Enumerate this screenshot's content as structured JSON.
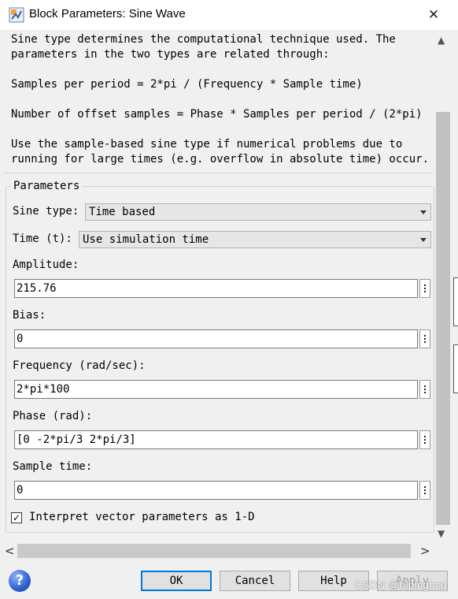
{
  "window": {
    "title": "Block Parameters: Sine Wave",
    "close_glyph": "✕",
    "icon": "simulink-block-icon"
  },
  "description": {
    "paragraph1": "Sine type determines the computational technique used. The\nparameters in the two types are related through:",
    "formula1": "Samples per period = 2*pi / (Frequency * Sample time)",
    "formula2": "Number of offset samples = Phase * Samples per period / (2*pi)",
    "paragraph2": "Use the sample-based sine type if numerical problems due to\nrunning for large times (e.g. overflow in absolute time) occur."
  },
  "parameters": {
    "group_title": "Parameters",
    "sine_type": {
      "label": "Sine type:",
      "value": "Time based"
    },
    "time": {
      "label": "Time (t):",
      "value": "Use simulation time"
    },
    "amplitude": {
      "label": "Amplitude:",
      "value": "215.76"
    },
    "bias": {
      "label": "Bias:",
      "value": "0"
    },
    "frequency": {
      "label": "Frequency (rad/sec):",
      "value": "2*pi*100"
    },
    "phase": {
      "label": "Phase (rad):",
      "value": "[0 -2*pi/3 2*pi/3]"
    },
    "sample_time": {
      "label": "Sample time:",
      "value": "0"
    },
    "interpret_vector": {
      "label": "Interpret vector parameters as 1-D",
      "checked": true,
      "check_glyph": "✓"
    }
  },
  "scroll": {
    "up": "▲",
    "down": "▼",
    "left": "<",
    "right": ">"
  },
  "buttons": {
    "help_icon": "?",
    "ok": "OK",
    "cancel": "Cancel",
    "help": "Help",
    "apply": "Apply"
  },
  "watermark": "CSDN @hlpinghcg"
}
